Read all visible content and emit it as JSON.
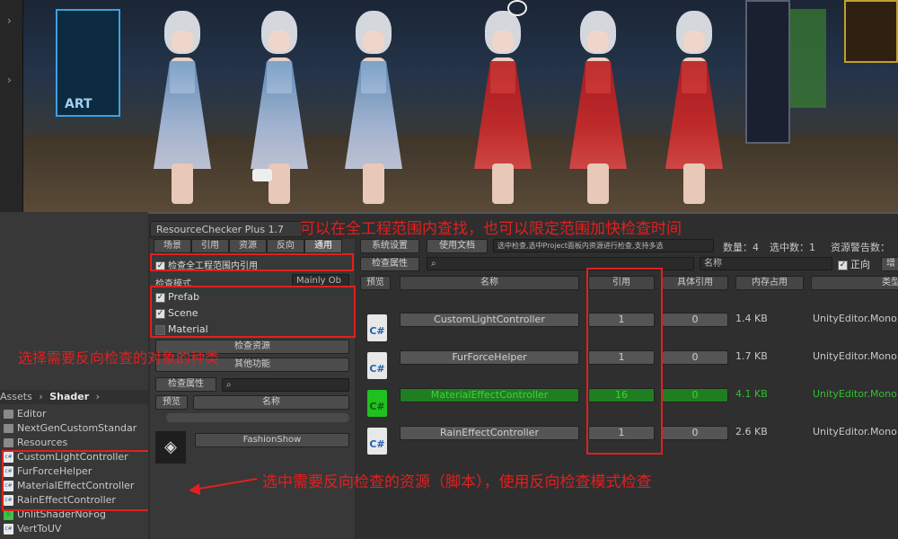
{
  "scene": {
    "label": "Unity Scene View: six anime characters in blue and red dresses",
    "sign_text": "ART"
  },
  "project": {
    "breadcrumb_assets": "Assets",
    "breadcrumb_sep": "›",
    "breadcrumb_folder": "Shader",
    "folders": [
      "Editor",
      "NextGenCustomStandar",
      "Resources"
    ],
    "files": [
      {
        "name": "CustomLightController",
        "icon": "csharp-icon"
      },
      {
        "name": "FurForceHelper",
        "icon": "csharp-icon"
      },
      {
        "name": "MaterialEffectController",
        "icon": "csharp-icon"
      },
      {
        "name": "RainEffectController",
        "icon": "csharp-icon"
      },
      {
        "name": "UnlitShaderNoFog",
        "icon": "shader-icon"
      },
      {
        "name": "VertToUV",
        "icon": "csharp-icon"
      }
    ]
  },
  "window": {
    "title": "ResourceChecker Plus 1.7",
    "tabs": [
      "场景",
      "引用",
      "资源",
      "反向",
      "通用"
    ],
    "active_tab": "反向",
    "global_check_label": "检查全工程范围内引用",
    "check_mode_label": "检查模式",
    "check_mode_value": "Mainly Ob",
    "types": [
      {
        "label": "Prefab",
        "checked": true
      },
      {
        "label": "Scene",
        "checked": true
      },
      {
        "label": "Material",
        "checked": false
      }
    ],
    "check_resource_btn": "检查资源",
    "other_func_btn": "其他功能",
    "check_attr_btn": "检查属性",
    "preview_label": "预览",
    "name_label": "名称",
    "result_item": "FashionShow"
  },
  "toolbar": {
    "system_settings": "系统设置",
    "docs": "使用文档",
    "selection_mode": "选中检查,选中Project面板内资源进行检查,支持多选",
    "count_label": "数量：4",
    "selected_label": "选中数：1",
    "warning_label": "资源警告数：",
    "check_attr": "检查属性",
    "search_placeholder": "",
    "sort_value": "名称",
    "positive_label": "正向",
    "add_label": "增"
  },
  "table": {
    "headers": [
      "预览",
      "名称",
      "引用",
      "具体引用",
      "内存占用",
      "类型"
    ],
    "rows": [
      {
        "name": "CustomLightController",
        "ref": "1",
        "detail": "0",
        "mem": "1.4 KB",
        "type": "UnityEditor.Mono",
        "highlight": false
      },
      {
        "name": "FurForceHelper",
        "ref": "1",
        "detail": "0",
        "mem": "1.7 KB",
        "type": "UnityEditor.Mono",
        "highlight": false
      },
      {
        "name": "MaterialEffectController",
        "ref": "16",
        "detail": "0",
        "mem": "4.1 KB",
        "type": "UnityEditor.Mono",
        "highlight": true
      },
      {
        "name": "RainEffectController",
        "ref": "1",
        "detail": "0",
        "mem": "2.6 KB",
        "type": "UnityEditor.Mono",
        "highlight": false
      }
    ]
  },
  "annotations": {
    "top": "可以在全工程范围内查找，也可以限定范围加快检查时间",
    "left": "选择需要反向检查的对象的种类",
    "bottom": "选中需要反向检查的资源（脚本），使用反向检查模式检查"
  },
  "colors": {
    "annotation": "#e02020",
    "highlight_row": "#30c030"
  }
}
